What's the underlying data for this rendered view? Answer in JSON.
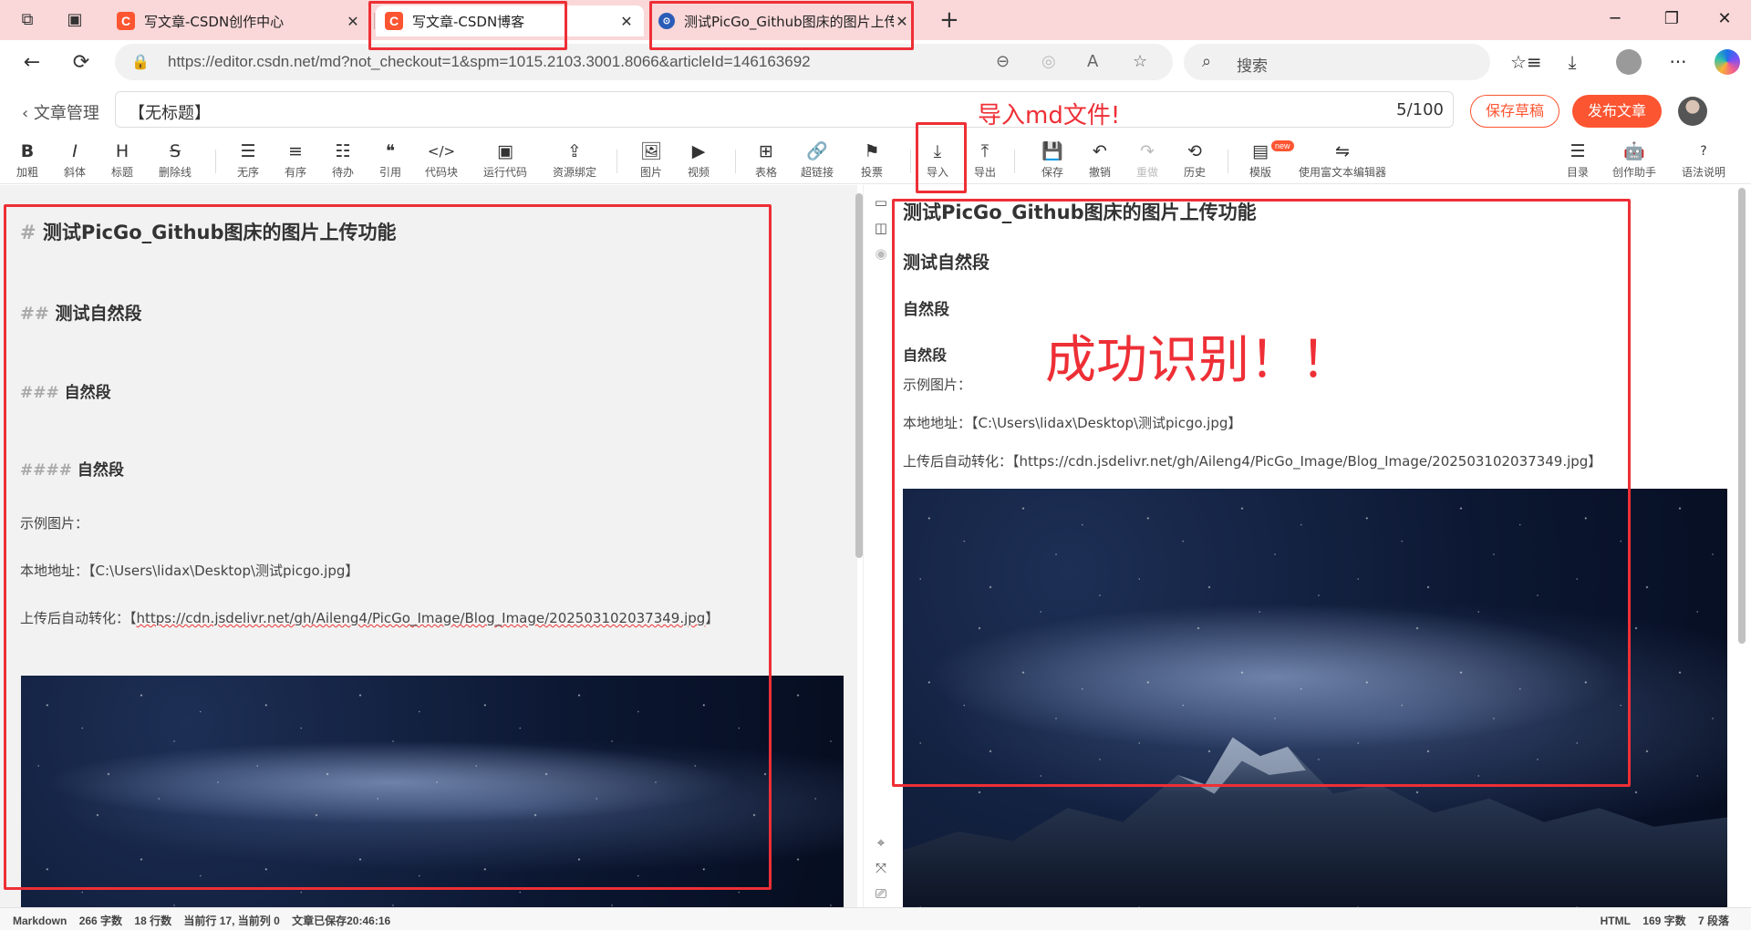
{
  "browser": {
    "tabs": [
      {
        "title": "写文章-CSDN创作中心"
      },
      {
        "title": "写文章-CSDN博客"
      },
      {
        "title": "测试PicGo_Github图床的图片上传"
      }
    ],
    "url": "https://editor.csdn.net/md?not_checkout=1&spm=1015.2103.3001.8066&articleId=146163692",
    "search_placeholder": "搜索",
    "icons": {
      "workspaces": "workspaces-icon",
      "tab_actions": "tab-actions-icon",
      "back": "←",
      "refresh": "⟳",
      "lock": "🔒",
      "new_tab": "+",
      "minimize": "─",
      "maximize": "❐",
      "close": "✕",
      "zoom": "⊖",
      "read_aloud": "A",
      "favorite": "☆",
      "favorites": "☆≡",
      "download": "⤓",
      "more": "···"
    }
  },
  "editor": {
    "back_label": "文章管理",
    "title_value": "【无标题】",
    "title_count": "5/100",
    "save_draft": "保存草稿",
    "publish": "发布文章",
    "toolbar": [
      {
        "icon": "B",
        "label": "加粗"
      },
      {
        "icon": "I",
        "label": "斜体"
      },
      {
        "icon": "H",
        "label": "标题"
      },
      {
        "icon": "S",
        "label": "删除线"
      },
      {
        "icon": "☰",
        "label": "无序"
      },
      {
        "icon": "≡",
        "label": "有序"
      },
      {
        "icon": "☷",
        "label": "待办"
      },
      {
        "icon": "❝",
        "label": "引用"
      },
      {
        "icon": "</>",
        "label": "代码块"
      },
      {
        "icon": "▣",
        "label": "运行代码"
      },
      {
        "icon": "⇪",
        "label": "资源绑定"
      },
      {
        "icon": "🖼",
        "label": "图片"
      },
      {
        "icon": "▶",
        "label": "视频"
      },
      {
        "icon": "⊞",
        "label": "表格"
      },
      {
        "icon": "🔗",
        "label": "超链接"
      },
      {
        "icon": "⚑",
        "label": "投票"
      },
      {
        "icon": "⤓",
        "label": "导入"
      },
      {
        "icon": "⤒",
        "label": "导出"
      },
      {
        "icon": "💾",
        "label": "保存"
      },
      {
        "icon": "↶",
        "label": "撤销"
      },
      {
        "icon": "↷",
        "label": "重做"
      },
      {
        "icon": "⟲",
        "label": "历史"
      },
      {
        "icon": "▤",
        "label": "模版"
      },
      {
        "icon": "⇋",
        "label": "使用富文本编辑器"
      },
      {
        "icon": "☰",
        "label": "目录"
      },
      {
        "icon": "🤖",
        "label": "创作助手"
      },
      {
        "icon": "?",
        "label": "语法说明"
      }
    ],
    "new_badge": "new",
    "markdown": {
      "h1_hash": "#",
      "h1": "测试PicGo_Github图床的图片上传功能",
      "h2_hash": "##",
      "h2": "测试自然段",
      "h3_hash": "###",
      "h3": "自然段",
      "h4_hash": "####",
      "h4": "自然段",
      "example": "示例图片：",
      "local_prefix": "本地地址：【C:\\Users\\lidax\\Desktop\\测试picgo.jpg】",
      "upload_prefix": "上传后自动转化：【",
      "upload_url": "https://cdn.jsdelivr.net/gh/Aileng4/PicGo_Image/Blog_Image/202503102037349.jpg",
      "upload_suffix": "】"
    },
    "preview": {
      "h1": "测试PicGo_Github图床的图片上传功能",
      "h2": "测试自然段",
      "h3": "自然段",
      "h4": "自然段",
      "example": "示例图片：",
      "local": "本地地址：【C:\\Users\\lidax\\Desktop\\测试picgo.jpg】",
      "upload": "上传后自动转化：【https://cdn.jsdelivr.net/gh/Aileng4/PicGo_Image/Blog_Image/202503102037349.jpg】"
    },
    "statusbar": {
      "mode": "Markdown",
      "words": "266 字数",
      "lines": "18 行数",
      "cursor": "当前行 17, 当前列 0",
      "saved": "文章已保存20:46:16",
      "right_mode": "HTML",
      "right_words": "169 字数",
      "right_paras": "7 段落"
    }
  },
  "annotations": {
    "import_md": "导入md文件!",
    "success": "成功识别！！",
    "color": "#ee2f36"
  },
  "colors": {
    "tabstrip": "#fad7d8",
    "brand": "#fc5531"
  }
}
